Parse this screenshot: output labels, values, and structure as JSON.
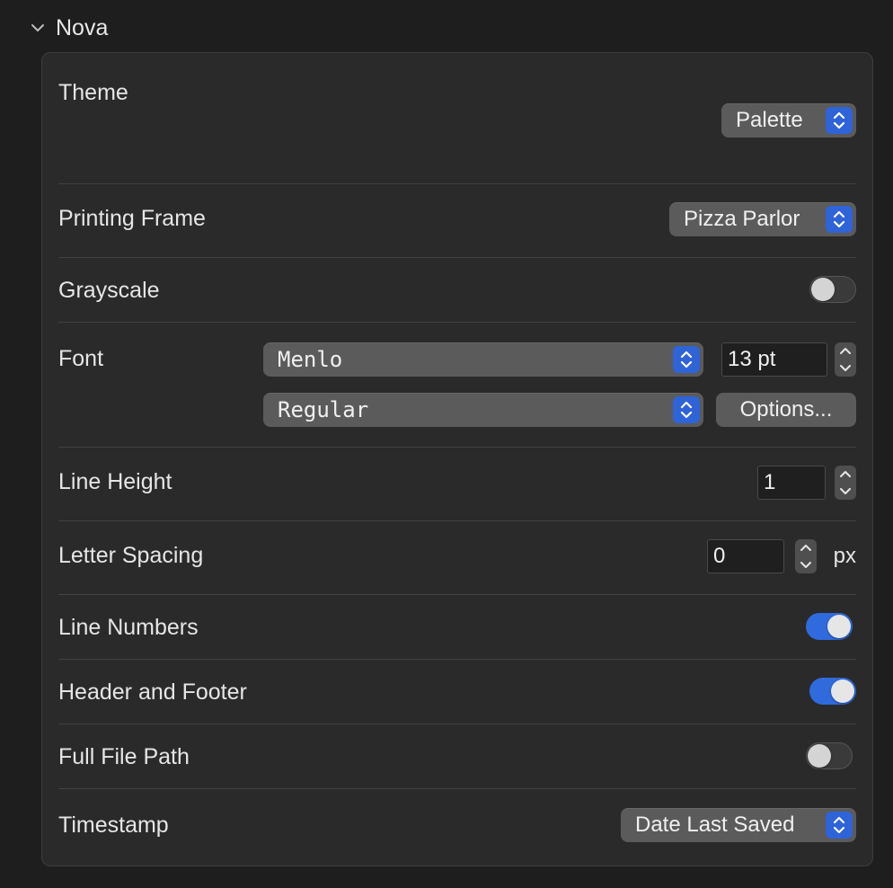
{
  "section": {
    "title": "Nova"
  },
  "theme": {
    "label": "Theme",
    "value": "Palette"
  },
  "printing_frame": {
    "label": "Printing Frame",
    "value": "Pizza Parlor"
  },
  "grayscale": {
    "label": "Grayscale",
    "on": false
  },
  "font": {
    "label": "Font",
    "family": "Menlo",
    "size": "13 pt",
    "style": "Regular",
    "options_label": "Options..."
  },
  "line_height": {
    "label": "Line Height",
    "value": "1"
  },
  "letter_spacing": {
    "label": "Letter Spacing",
    "value": "0",
    "unit": "px"
  },
  "line_numbers": {
    "label": "Line Numbers",
    "on": true
  },
  "header_footer": {
    "label": "Header and Footer",
    "on": true
  },
  "full_file_path": {
    "label": "Full File Path",
    "on": false
  },
  "timestamp": {
    "label": "Timestamp",
    "value": "Date Last Saved"
  },
  "colors": {
    "accent": "#2f6bdc",
    "panel": "#2a2a2a",
    "background": "#1e1e1e"
  }
}
